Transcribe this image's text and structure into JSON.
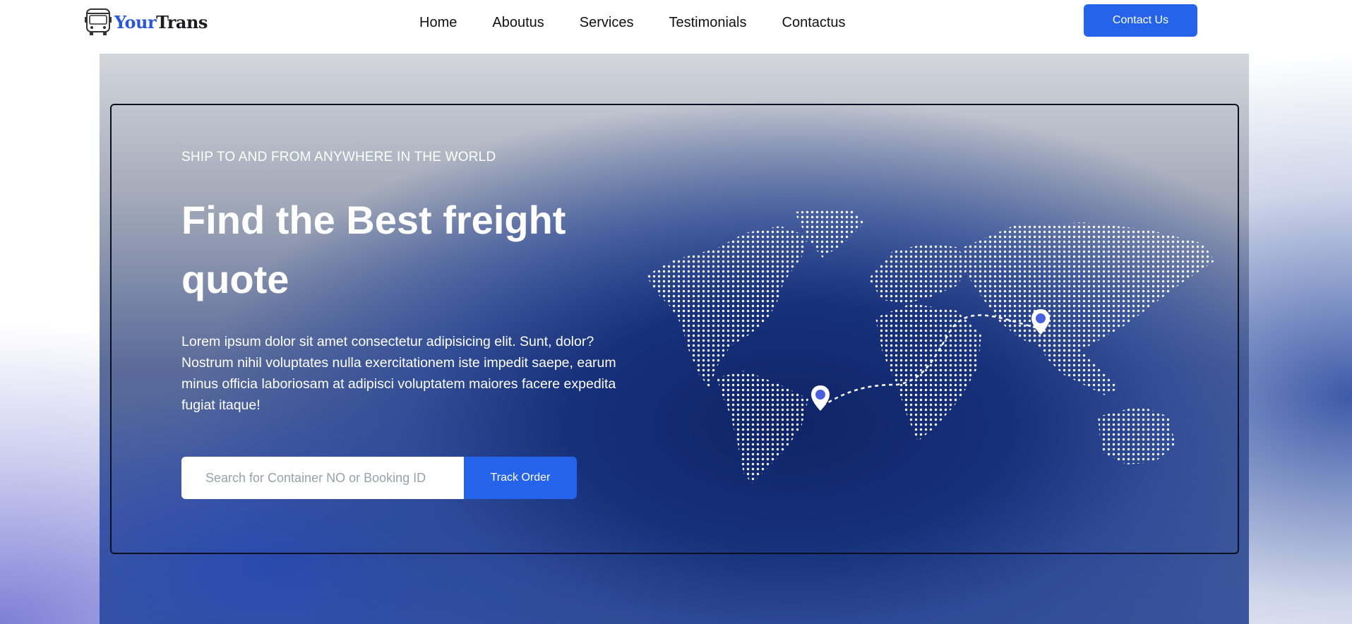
{
  "brand": {
    "name_part1": "Your",
    "name_part2": "Trans"
  },
  "nav": {
    "items": [
      {
        "label": "Home"
      },
      {
        "label": "Aboutus"
      },
      {
        "label": "Services"
      },
      {
        "label": "Testimonials"
      },
      {
        "label": "Contactus"
      }
    ]
  },
  "header": {
    "contact_label": "Contact Us"
  },
  "hero": {
    "eyebrow": "SHIP TO AND FROM ANYWHERE IN THE WORLD",
    "headline": "Find the Best freight quote",
    "description": "Lorem ipsum dolor sit amet consectetur adipisicing elit. Sunt, dolor? Nostrum nihil voluptates nulla exercitationem iste impedit saepe, earum minus officia laboriosam at adipisci voluptatem maiores facere expedita fugiat itaque!",
    "search": {
      "placeholder": "Search for Container NO or Booking ID",
      "value": ""
    },
    "track_label": "Track Order"
  },
  "icons": {
    "logo": "bus-icon",
    "map": "world-map-dotted",
    "pins": [
      "location-pin-icon",
      "location-pin-icon"
    ]
  },
  "colors": {
    "accent": "#2563eb",
    "brand_accent": "#2a56d9",
    "hero_dark": "#0f2466",
    "text_light": "#ffffff"
  }
}
